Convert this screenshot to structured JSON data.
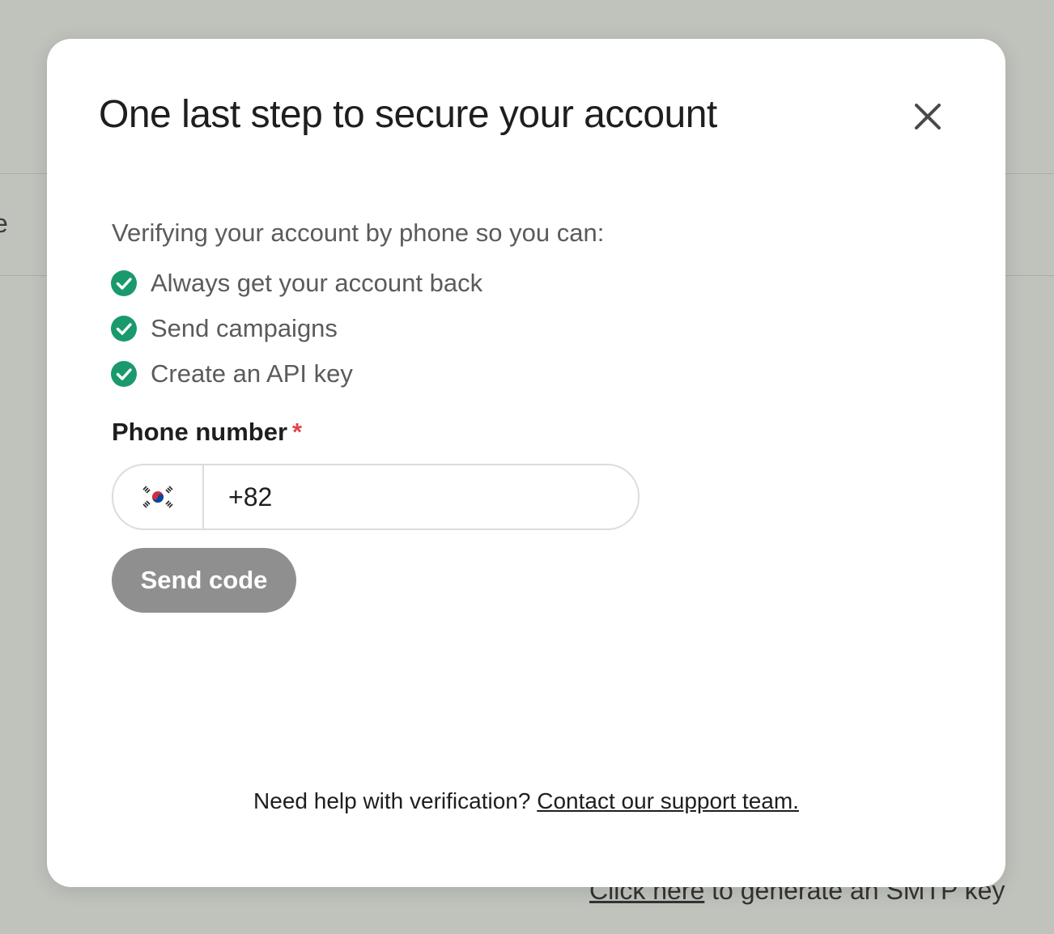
{
  "background": {
    "partial_text": "e",
    "footer_link": "Click here",
    "footer_text": " to generate an SMTP key"
  },
  "modal": {
    "title": "One last step to secure your account",
    "close_icon": "close-icon",
    "intro": "Verifying your account by phone so you can:",
    "benefits": [
      "Always get your account back",
      "Send campaigns",
      "Create an API key"
    ],
    "check_icon": "check-circle-icon",
    "check_color": "#1a9a6c",
    "phone": {
      "label": "Phone number",
      "required_mark": "*",
      "country_flag": "south-korea-flag-icon",
      "value": "+82"
    },
    "send_button": "Send code",
    "help": {
      "text": "Need help with verification? ",
      "link": "Contact our support team."
    }
  }
}
